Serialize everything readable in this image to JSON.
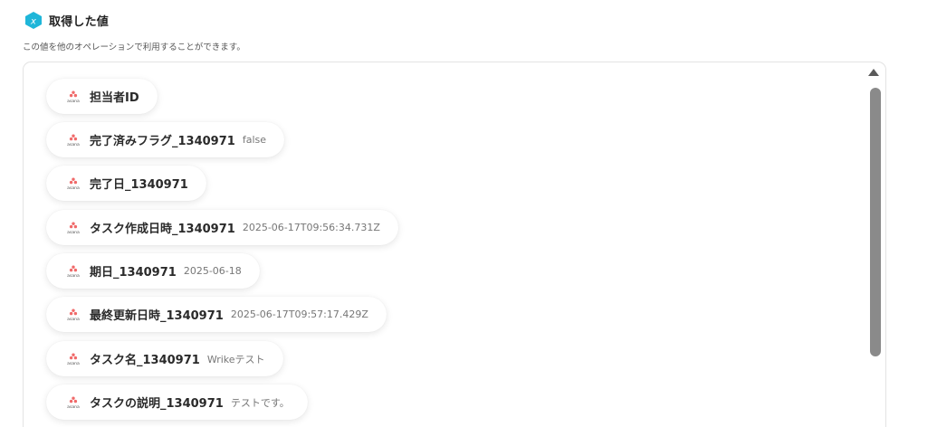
{
  "header": {
    "title": "取得した値",
    "subtitle": "この値を他のオペレーションで利用することができます。",
    "icon": "variable-x-hexagon-icon",
    "icon_color": "#1fb6d9"
  },
  "values": [
    {
      "label": "担当者ID",
      "value": ""
    },
    {
      "label": "完了済みフラグ_1340971",
      "value": "false"
    },
    {
      "label": "完了日_1340971",
      "value": ""
    },
    {
      "label": "タスク作成日時_1340971",
      "value": "2025-06-17T09:56:34.731Z"
    },
    {
      "label": "期日_1340971",
      "value": "2025-06-18"
    },
    {
      "label": "最終更新日時_1340971",
      "value": "2025-06-17T09:57:17.429Z"
    },
    {
      "label": "タスク名_1340971",
      "value": "Wrikeテスト"
    },
    {
      "label": "タスクの説明_1340971",
      "value": "テストです。"
    }
  ],
  "source_icon": "asana-logo-icon",
  "colors": {
    "asana_dots": "#f06a6a",
    "scrollbar_thumb": "#8a8a8a"
  }
}
